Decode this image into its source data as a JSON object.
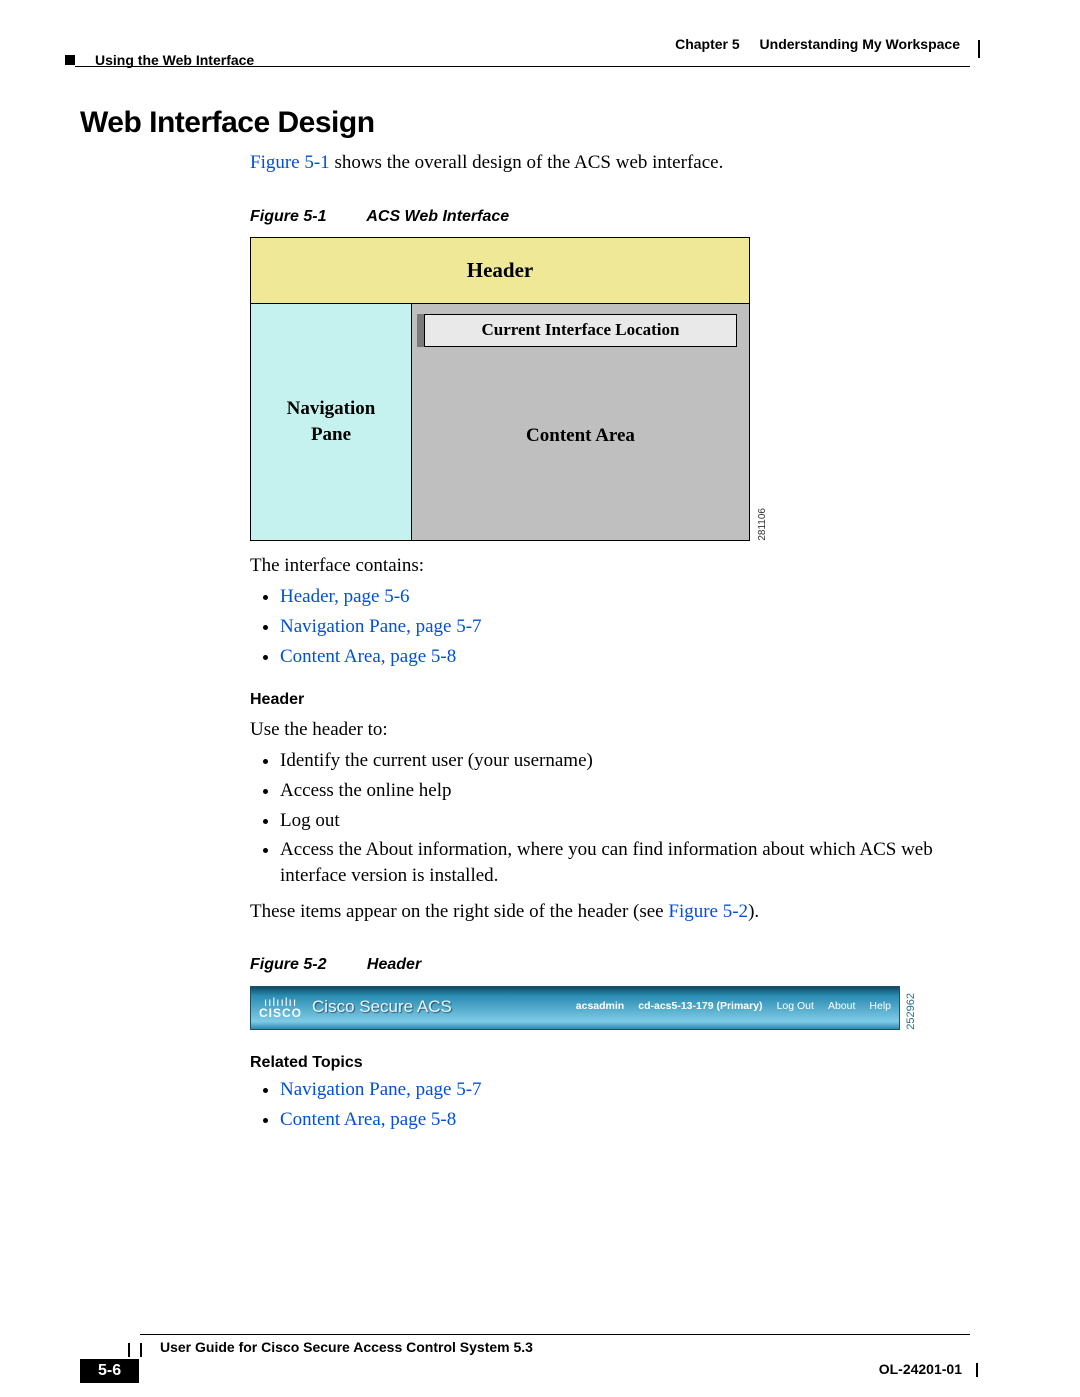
{
  "runningHead": {
    "leftSection": "Using the Web Interface",
    "chapterLabel": "Chapter 5",
    "chapterTitle": "Understanding My Workspace"
  },
  "section": {
    "title": "Web Interface Design",
    "introLinkText": "Figure 5-1",
    "introRest": " shows the overall design of the ACS web interface."
  },
  "figure1": {
    "captionNum": "Figure 5-1",
    "captionTitle": "ACS Web Interface",
    "labels": {
      "header": "Header",
      "navLine1": "Navigation",
      "navLine2": "Pane",
      "location": "Current Interface Location",
      "content": "Content Area"
    },
    "sideNumber": "281106"
  },
  "afterFig1": {
    "lead": "The interface contains:",
    "links": [
      "Header, page 5-6",
      "Navigation Pane, page 5-7",
      "Content Area, page 5-8"
    ]
  },
  "headerSection": {
    "title": "Header",
    "lead": "Use the header to:",
    "items": [
      "Identify the current user (your username)",
      "Access the online help",
      "Log out",
      "Access the About information, where you can find information about which ACS web interface version is installed."
    ],
    "tailPre": "These items appear on the right side of the header (see ",
    "tailLink": "Figure 5-2",
    "tailPost": ")."
  },
  "figure2": {
    "captionNum": "Figure 5-2",
    "captionTitle": "Header",
    "logoBars": "ıılıılıı",
    "logoText": "CISCO",
    "product": "Cisco Secure ACS",
    "user": "acsadmin",
    "host": "cd-acs5-13-179 (Primary)",
    "links": {
      "logout": "Log Out",
      "about": "About",
      "help": "Help"
    },
    "sideNumber": "252962"
  },
  "related": {
    "title": "Related Topics",
    "links": [
      "Navigation Pane, page 5-7",
      "Content Area, page 5-8"
    ]
  },
  "footer": {
    "bookTitle": "User Guide for Cisco Secure Access Control System 5.3",
    "pageBadge": "5-6",
    "docNumber": "OL-24201-01"
  }
}
